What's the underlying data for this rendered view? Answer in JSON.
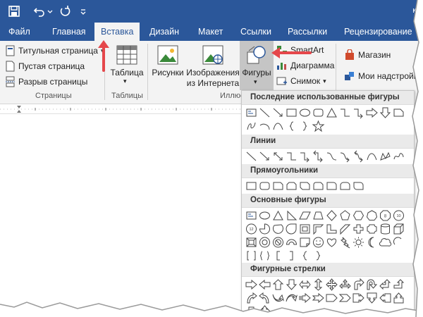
{
  "titlebar": {
    "corner_text": "к"
  },
  "tabs": [
    {
      "label": "Файл"
    },
    {
      "label": "Главная"
    },
    {
      "label": "Вставка",
      "active": true
    },
    {
      "label": "Дизайн"
    },
    {
      "label": "Макет"
    },
    {
      "label": "Ссылки"
    },
    {
      "label": "Рассылки"
    },
    {
      "label": "Рецензирование"
    }
  ],
  "ribbon": {
    "pages": {
      "cover_page": "Титульная страница",
      "blank_page": "Пустая страница",
      "page_break": "Разрыв страницы",
      "group_label": "Страницы"
    },
    "tables": {
      "table": "Таблица",
      "group_label": "Таблицы"
    },
    "illustrations": {
      "pictures": "Рисунки",
      "online_pictures_line1": "Изображения",
      "online_pictures_line2": "из Интернета",
      "shapes": "Фигуры",
      "smartart": "SmartArt",
      "chart": "Диаграмма",
      "screenshot": "Снимок",
      "group_label": "Иллюс"
    },
    "addins": {
      "store": "Магазин",
      "my_addins": "Мои надстройк"
    }
  },
  "shapes_menu": {
    "sections": [
      {
        "title": "Последние использованные фигуры"
      },
      {
        "title": "Линии"
      },
      {
        "title": "Прямоугольники"
      },
      {
        "title": "Основные фигуры"
      },
      {
        "title": "Фигурные стрелки"
      }
    ]
  },
  "colors": {
    "ribbon_blue": "#2b579a",
    "ribbon_bg": "#f3f3f3",
    "annotation_red": "#e5474b"
  }
}
